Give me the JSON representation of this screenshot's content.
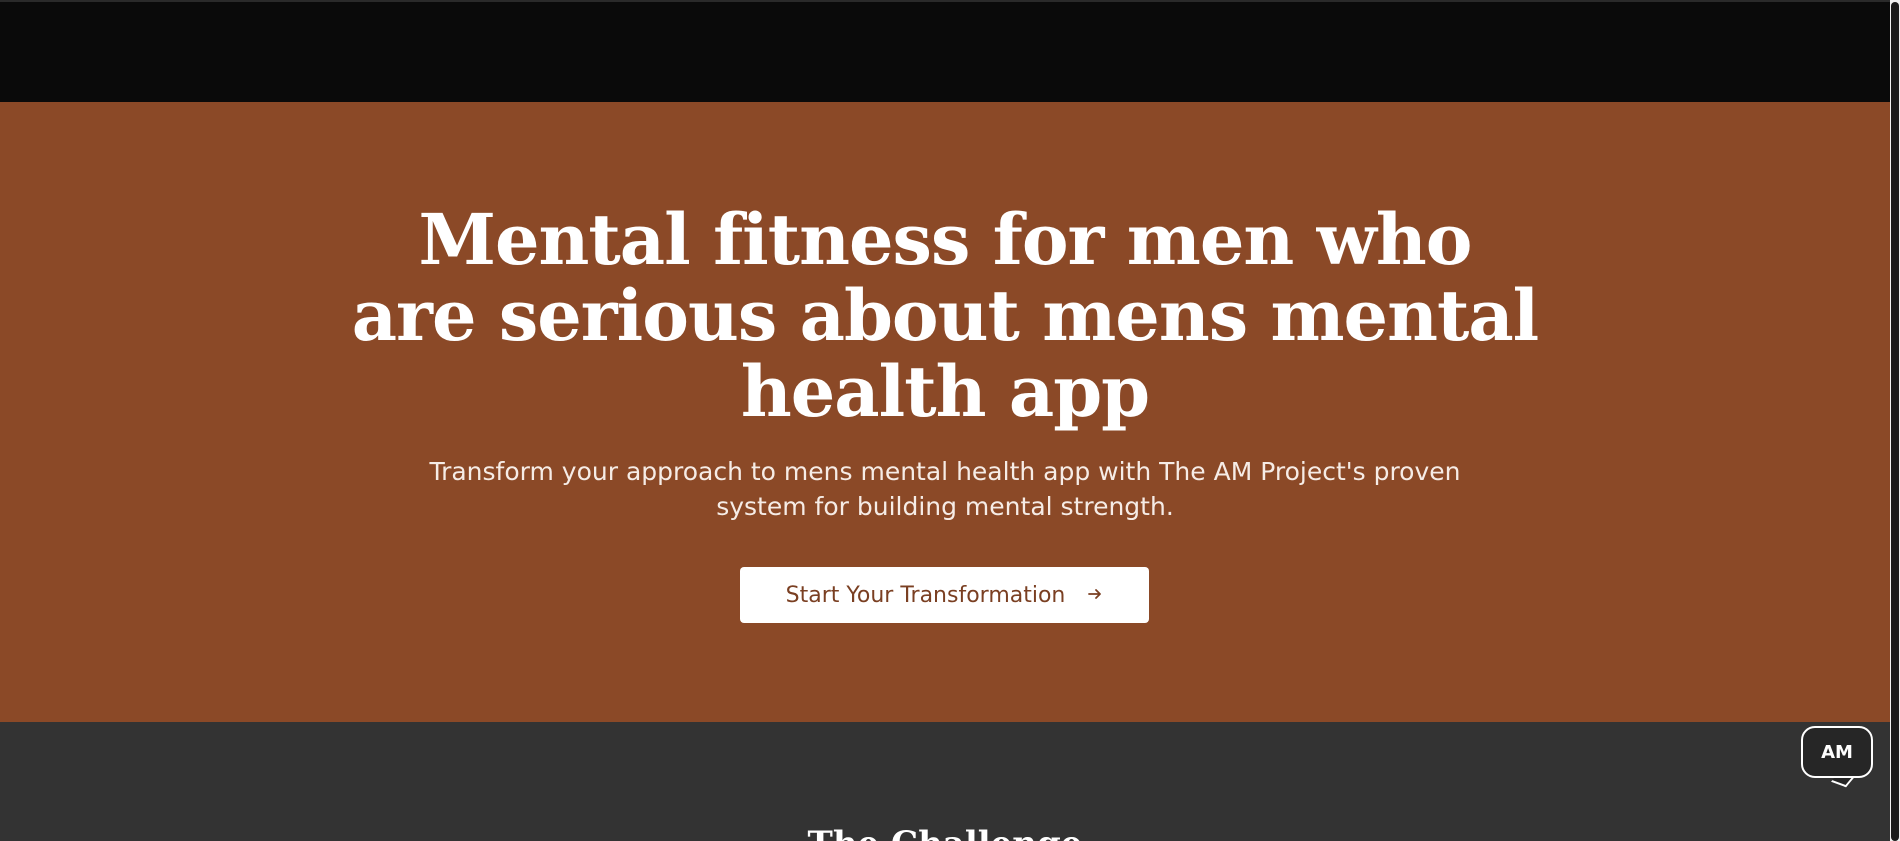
{
  "hero": {
    "title": "Mental fitness for men who are serious about mens mental health app",
    "subtitle": "Transform your approach to mens mental health app with The AM Project's proven system for building mental strength.",
    "cta_label": "Start Your Transformation",
    "cta_icon": "arrow-right-icon"
  },
  "next_section": {
    "title": "The Challenge"
  },
  "chat_badge": {
    "label": "AM"
  },
  "colors": {
    "topbar": "#0a0a0a",
    "hero_background": "#8b4927",
    "section_background": "#333333",
    "button_background": "#ffffff",
    "button_text": "#7a3f22"
  }
}
